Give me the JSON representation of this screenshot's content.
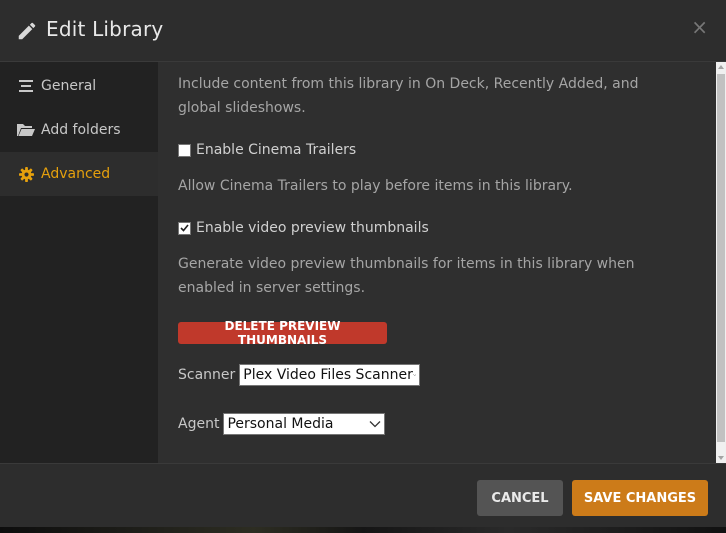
{
  "header": {
    "title": "Edit Library",
    "close_glyph": "×",
    "icon": "pencil-icon"
  },
  "sidebar": {
    "items": [
      {
        "label": "General",
        "icon": "list-icon",
        "active": false
      },
      {
        "label": "Add folders",
        "icon": "folder-open-icon",
        "active": false
      },
      {
        "label": "Advanced",
        "icon": "gear-icon",
        "active": true
      }
    ]
  },
  "content": {
    "intro_help": "Include content from this library in On Deck, Recently Added, and global slideshows.",
    "cinema_trailers": {
      "label": "Enable Cinema Trailers",
      "checked": false,
      "help": "Allow Cinema Trailers to play before items in this library."
    },
    "video_thumbnails": {
      "label": "Enable video preview thumbnails",
      "checked": true,
      "help": "Generate video preview thumbnails for items in this library when enabled in server settings."
    },
    "delete_thumbnails_label": "DELETE PREVIEW THUMBNAILS",
    "scanner": {
      "label": "Scanner",
      "value": "Plex Video Files Scanner"
    },
    "agent": {
      "label": "Agent",
      "value": "Personal Media"
    }
  },
  "footer": {
    "cancel_label": "CANCEL",
    "save_label": "SAVE CHANGES"
  },
  "colors": {
    "accent": "#e5a00d",
    "save_button": "#cc7b19",
    "danger_button": "#c0392b"
  }
}
